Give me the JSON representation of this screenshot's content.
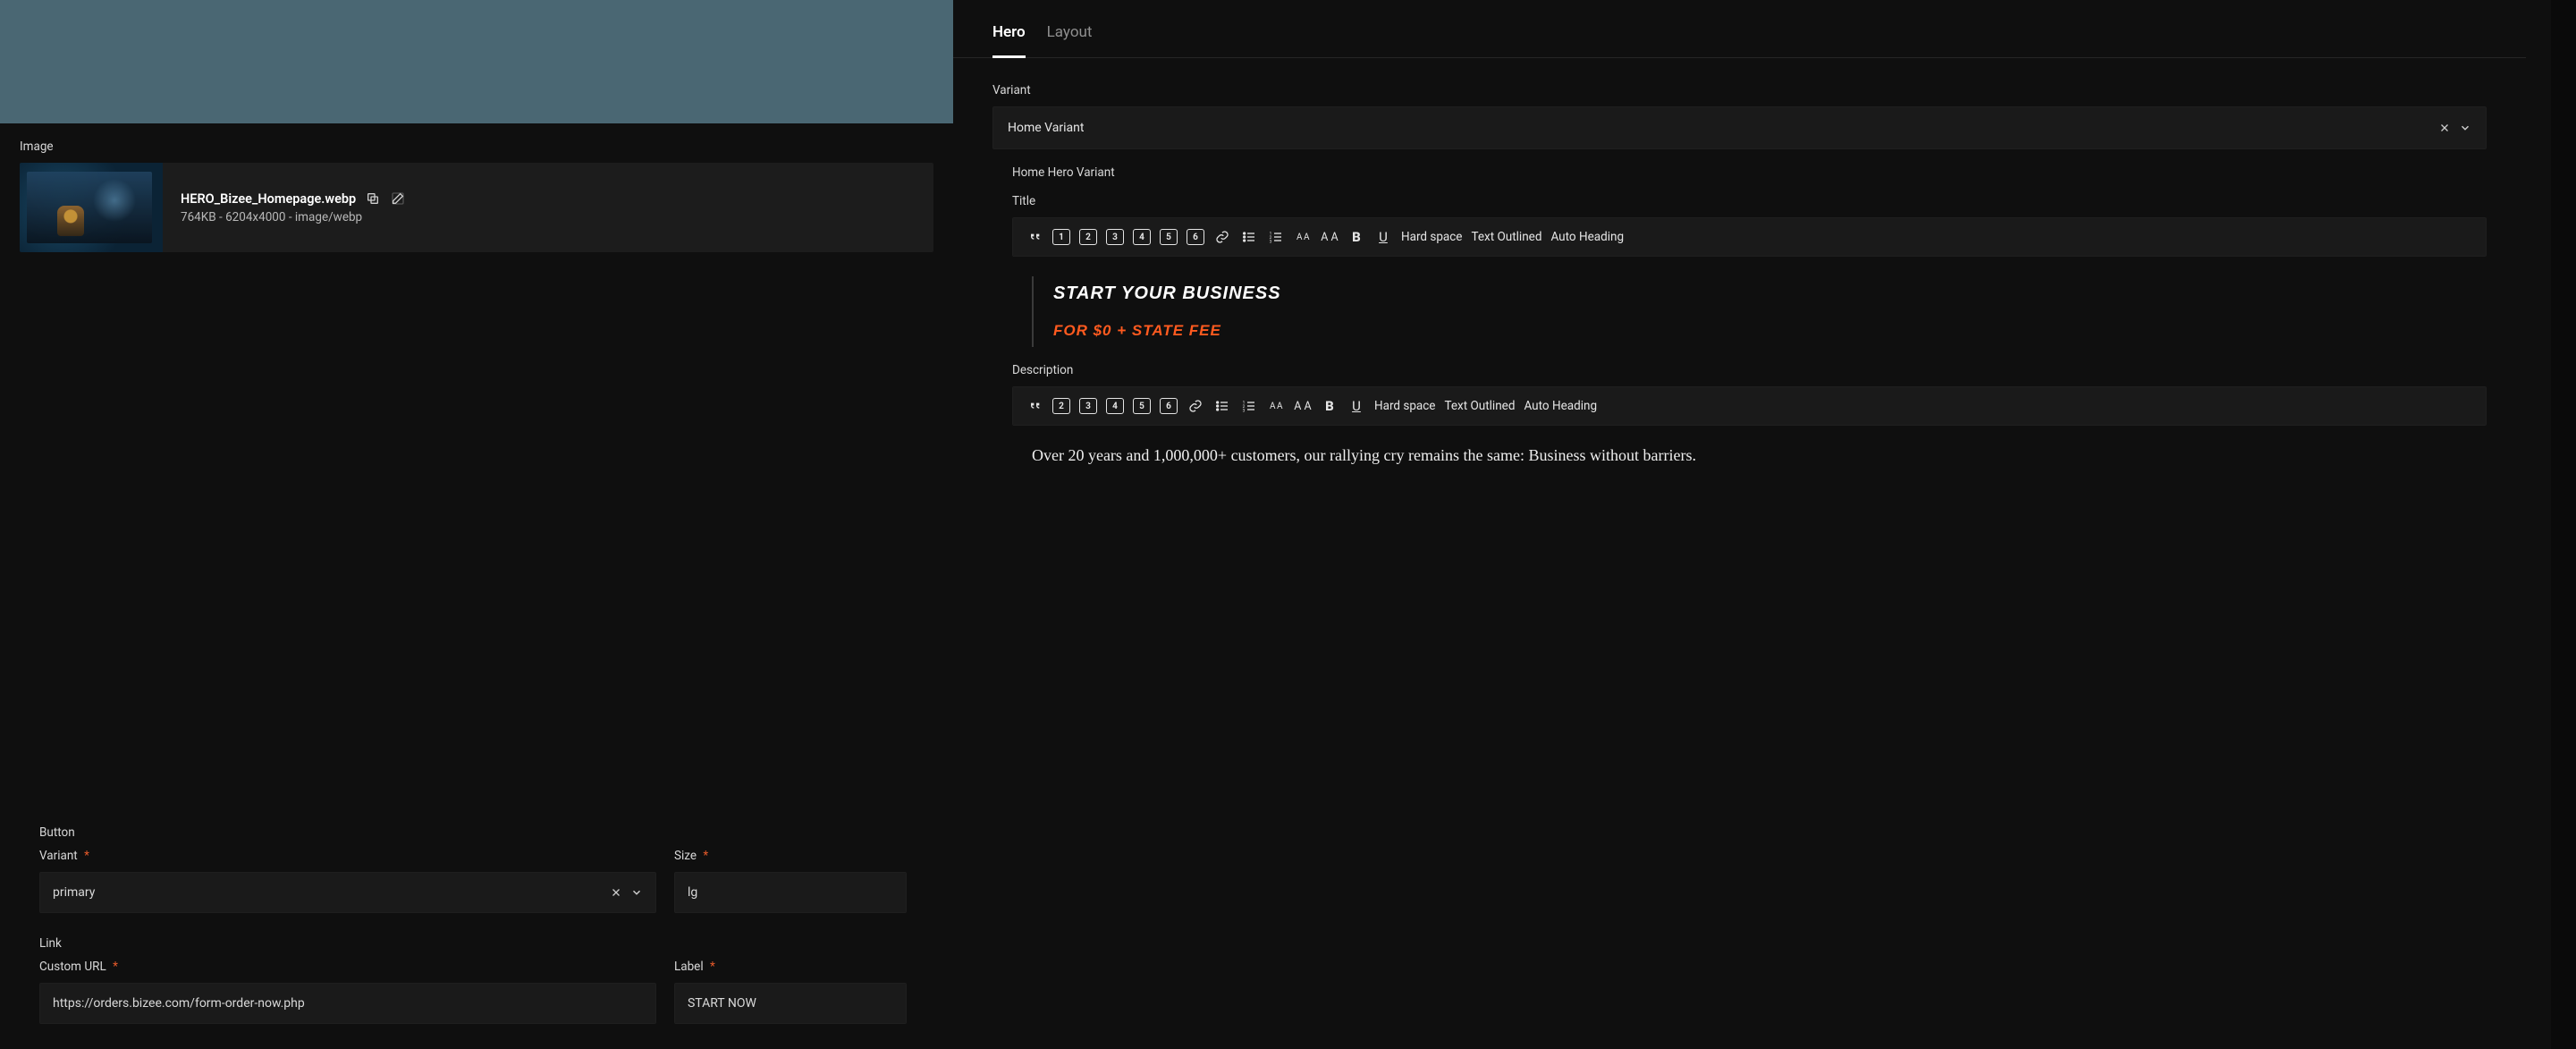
{
  "left": {
    "image_label": "Image",
    "image": {
      "filename": "HERO_Bizee_Homepage.webp",
      "meta": "764KB - 6204x4000 - image/webp"
    },
    "button_section_label": "Button",
    "variant_label": "Variant",
    "variant_value": "primary",
    "size_label": "Size",
    "size_value": "lg",
    "link_section_label": "Link",
    "url_label": "Custom URL",
    "url_value": "https://orders.bizee.com/form-order-now.php",
    "button_label_label": "Label",
    "button_label_value": "START NOW"
  },
  "right": {
    "tabs": {
      "hero": "Hero",
      "layout": "Layout"
    },
    "variant_label": "Variant",
    "variant_value": "Home Variant",
    "variant_section_title": "Home Hero Variant",
    "title_label": "Title",
    "title_line1": "START YOUR BUSINESS",
    "title_line2": "FOR $0 + STATE FEE",
    "description_label": "Description",
    "description_text": "Over 20 years and 1,000,000+ customers, our rallying cry remains the same: Business without barriers.",
    "toolbar": {
      "hard_space": "Hard space",
      "text_outlined": "Text Outlined",
      "auto_heading": "Auto Heading",
      "h1": "1",
      "h2": "2",
      "h3": "3",
      "h4": "4",
      "h5": "5",
      "h6": "6",
      "bold": "B",
      "underline": "U",
      "aa_sm": "A A",
      "aa_md": "A A"
    }
  },
  "required_mark": "*"
}
